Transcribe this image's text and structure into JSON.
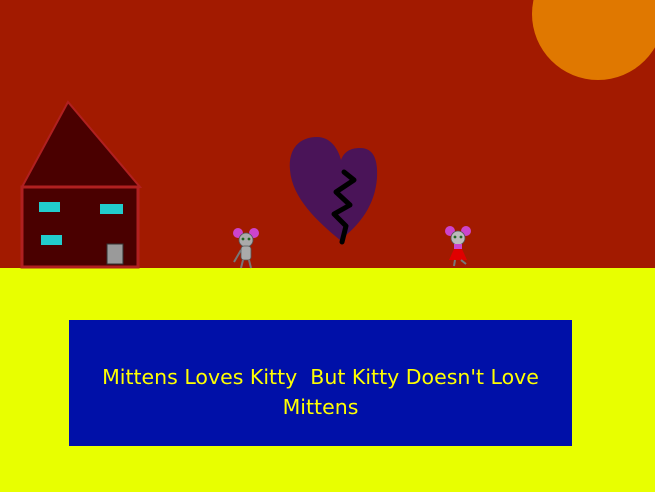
{
  "scene": {
    "colors": {
      "sky": "#a21a00",
      "ground": "#e8ff00",
      "sun": "#e07800",
      "house_wall": "#4a0000",
      "house_roof": "#4a0000",
      "house_outline": "#b02020",
      "window": "#22cccc",
      "door": "#9a9a9a",
      "heart": "#4a1458",
      "crack": "#000000",
      "caption_bg": "#0010a8",
      "caption_text": "#ffff00"
    },
    "characters": [
      {
        "role": "mittens",
        "description_icon": "gray-cat-icon"
      },
      {
        "role": "kitty",
        "description_icon": "cat-in-red-dress-icon"
      }
    ]
  },
  "caption": {
    "text": "Mittens Loves Kitty  But Kitty Doesn't Love Mittens"
  }
}
